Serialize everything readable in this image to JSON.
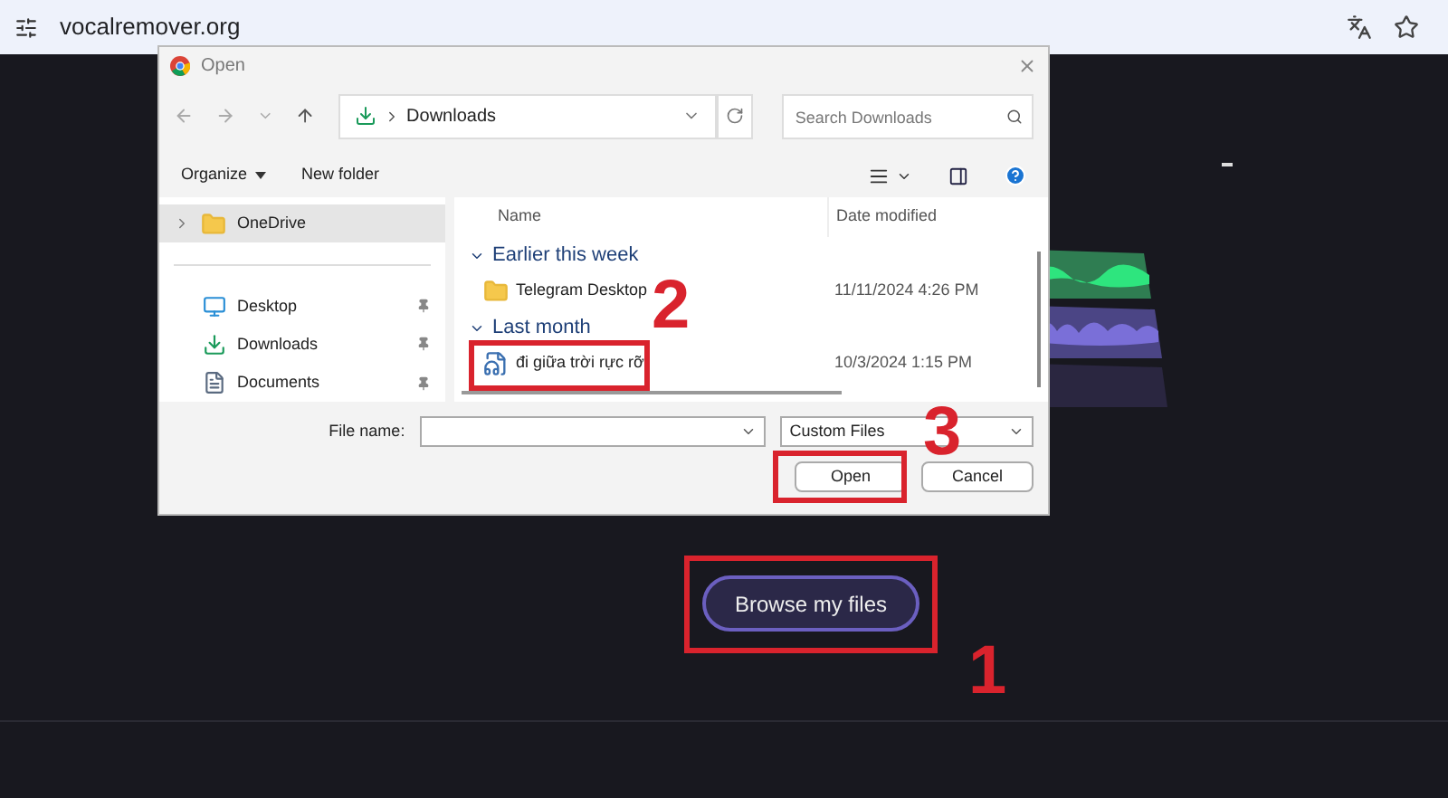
{
  "browser": {
    "url": "vocalremover.org"
  },
  "dialog": {
    "title": "Open",
    "path": "Downloads",
    "search": {
      "placeholder": "Search Downloads"
    },
    "toolbar": [
      "Organize",
      "New folder"
    ],
    "nav_pane": [
      {
        "label": "OneDrive",
        "kind": "cloud",
        "selected": true,
        "pinned": false
      },
      {
        "label": "Desktop",
        "kind": "desktop",
        "selected": false,
        "pinned": true
      },
      {
        "label": "Downloads",
        "kind": "downloads",
        "selected": false,
        "pinned": true
      },
      {
        "label": "Documents",
        "kind": "documents",
        "selected": false,
        "pinned": true
      }
    ],
    "columns": [
      "Name",
      "Date modified"
    ],
    "groups": [
      {
        "label": "Earlier this week",
        "expanded": true,
        "files": [
          {
            "name": "Telegram Desktop",
            "date": "11/11/2024 4:26 PM",
            "kind": "folder"
          }
        ]
      },
      {
        "label": "Last month",
        "expanded": true,
        "files": [
          {
            "name": "đi giữa trời rực rỡ",
            "date": "10/3/2024 1:15 PM",
            "kind": "audio"
          }
        ]
      }
    ],
    "file_name_label": "File name:",
    "file_type": "Custom Files",
    "buttons": [
      "Open",
      "Cancel"
    ]
  },
  "page": {
    "button": "Browse my files"
  },
  "annotations": [
    {
      "label": "1"
    },
    {
      "label": "2"
    },
    {
      "label": "3"
    }
  ]
}
